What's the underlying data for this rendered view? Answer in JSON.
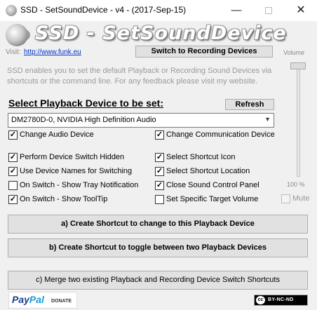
{
  "window": {
    "title": "SSD - SetSoundDevice - v4 - (2017-Sep-15)",
    "min_glyph": "—",
    "close_glyph": "✕"
  },
  "header": {
    "logo_text": "SSD - SetSoundDevice",
    "visit_label": "Visit:",
    "visit_link": "http://www.funk.eu",
    "switch_button": "Switch to Recording Devices",
    "volume_label": "Volume"
  },
  "description": "SSD enables you to set the default Playback or Recording Sound Devices via shortcuts or the command line. For any feedback please visit my website.",
  "device": {
    "heading": "Select Playback Device to be set:",
    "refresh_label": "Refresh",
    "selected": "DM2780D-0, NVIDIA High Definition Audio",
    "arrow_glyph": "▼"
  },
  "options": {
    "change_audio": {
      "label": "Change Audio Device",
      "checked": true,
      "mark": "✓"
    },
    "change_comm": {
      "label": "Change Communication Device",
      "checked": true,
      "mark": "✓"
    },
    "switch_hidden": {
      "label": "Perform Device Switch Hidden",
      "checked": true,
      "mark": "✓"
    },
    "shortcut_icon": {
      "label": "Select Shortcut Icon",
      "checked": true,
      "mark": "✓"
    },
    "device_names": {
      "label": "Use Device Names for Switching",
      "checked": true,
      "mark": "✓"
    },
    "shortcut_location": {
      "label": "Select Shortcut Location",
      "checked": true,
      "mark": "✓"
    },
    "tray_notification": {
      "label": "On Switch - Show Tray Notification",
      "checked": false,
      "mark": ""
    },
    "close_panel": {
      "label": "Close Sound Control Panel",
      "checked": true,
      "mark": "✓"
    },
    "tooltip": {
      "label": "On Switch - Show ToolTip",
      "checked": true,
      "mark": "✓"
    },
    "target_volume": {
      "label": "Set Specific Target Volume",
      "checked": false,
      "mark": ""
    }
  },
  "volume": {
    "percent_label": "100 %",
    "level": 1.0,
    "mute_label": "Mute",
    "mute_checked": false
  },
  "actions": {
    "create_a": "a) Create Shortcut to change to this Playback Device",
    "create_b": "b) Create Shortcut to toggle between two Playback Devices",
    "merge_c": "c) Merge two existing Playback and Recording Device Switch Shortcuts"
  },
  "footer": {
    "paypal_pay": "Pay",
    "paypal_pal": "Pal",
    "donate": "DONATE",
    "cc_symbol": "cc",
    "cc_license": "BY-NC-ND"
  }
}
